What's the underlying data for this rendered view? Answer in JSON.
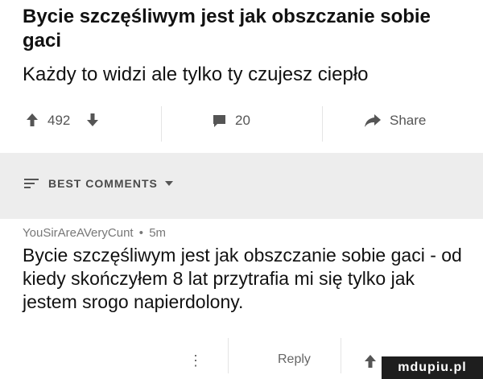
{
  "post": {
    "title": "Bycie szczęśliwym jest jak obszczanie sobie gaci",
    "subtitle": "Każdy to widzi ale tylko ty czujesz ciepło"
  },
  "actions": {
    "votes": "492",
    "comments": "20",
    "share_label": "Share"
  },
  "comments_section": {
    "header_label": "BEST COMMENTS"
  },
  "comment": {
    "author": "YouSirAreAVeryCunt",
    "separator": "•",
    "age": "5m",
    "text": "Bycie szczęśliwym jest jak obszczanie sobie gaci - od kiedy skończyłem 8 lat przytrafia mi się tylko jak jestem srogo napierdolony.",
    "more_label": "⋮",
    "reply_label": "Reply"
  },
  "watermark": {
    "text": "mdupiu.pl"
  },
  "colors": {
    "accent": "#555555",
    "section_bg": "#ededed"
  }
}
